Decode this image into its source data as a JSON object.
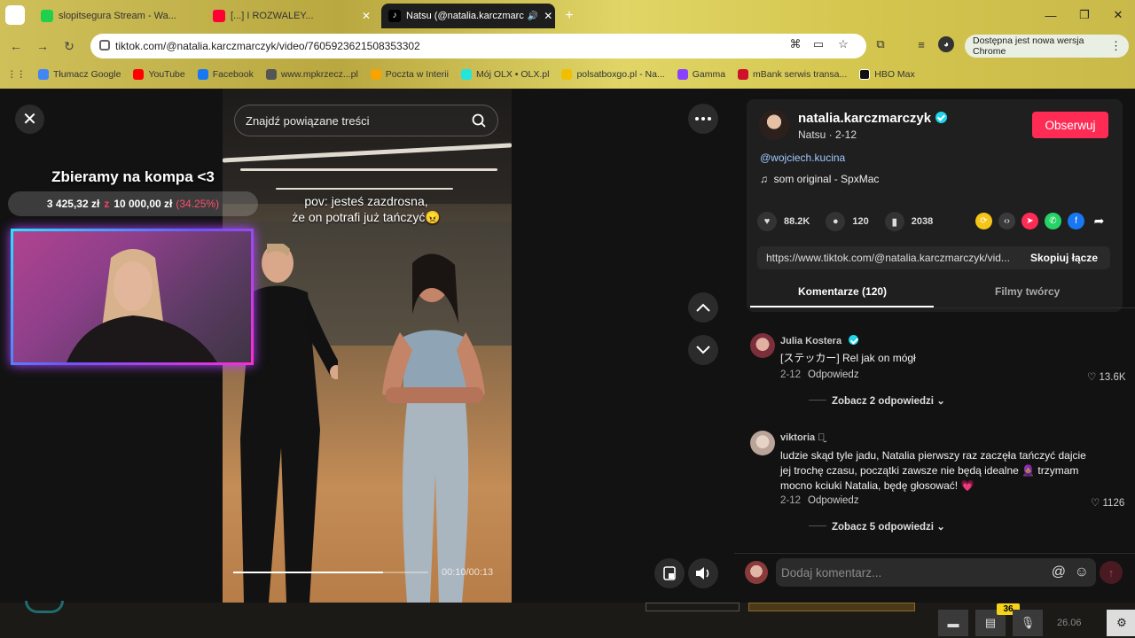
{
  "browser": {
    "tabs": [
      {
        "title": "slopitsegura Stream - Wa...",
        "color": "#20d04a"
      },
      {
        "title": "[...] I ROZWALEY...",
        "color": "#ff0033"
      },
      {
        "title": "Natsu (@natalia.karczmarc",
        "color": "#000000"
      }
    ],
    "new_tab_label": "+",
    "url": "tiktok.com/@natalia.karczmarczyk/video/7605923621508353302",
    "update_label": "Dostępna jest nowa wersja Chrome",
    "bookmarks": [
      {
        "label": "Tłumacz Google",
        "color": "#4285f4"
      },
      {
        "label": "YouTube",
        "color": "#ff0000"
      },
      {
        "label": "Facebook",
        "color": "#1877f2"
      },
      {
        "label": "www.mpkrzecz...pl",
        "color": "#555555"
      },
      {
        "label": "Poczta w Interii",
        "color": "#f7a300"
      },
      {
        "label": "Mój OLX • OLX.pl",
        "color": "#23e5db"
      },
      {
        "label": "polsatboxgo.pl - Na...",
        "color": "#f0c000"
      },
      {
        "label": "Gamma",
        "color": "#8a40ff"
      },
      {
        "label": "mBank serwis transa...",
        "color": "#d0102b"
      },
      {
        "label": "HBO Max",
        "color": "#111111"
      }
    ]
  },
  "player": {
    "search_placeholder": "Znajdź powiązane treści",
    "caption_line1": "pov: jesteś zazdrosna,",
    "caption_line2": "że on potrafi już tańczyć😠",
    "time": "00:10/00:13",
    "progress_fraction": 0.77
  },
  "overlay": {
    "title": "Zbieramy na kompa <3",
    "current": "3 425,32 zł",
    "separator": "z",
    "goal": "10 000,00 zł",
    "percent": "(34.25%)"
  },
  "author": {
    "username": "natalia.karczmarczyk",
    "nickname_date": "Natsu · 2-12",
    "follow_label": "Obserwuj",
    "mention": "@wojciech.kucina",
    "music": "som original - SpxMac"
  },
  "stats": {
    "likes": "88.2K",
    "comments": "120",
    "saves": "2038"
  },
  "share_colors": [
    "#f5c518",
    "#3a3a3a",
    "#fe2c55",
    "#25d366",
    "#1877f2"
  ],
  "link": {
    "url": "https://www.tiktok.com/@natalia.karczmarczyk/vid...",
    "copy_label": "Skopiuj łącze"
  },
  "tabs": {
    "comments": "Komentarze (120)",
    "creator_videos": "Filmy twórcy"
  },
  "comments": [
    {
      "author": "Julia Kostera",
      "text": "[ステッカー] Rel jak on mógł",
      "date": "2-12",
      "reply_label": "Odpowiedz",
      "likes": "13.6K",
      "more": "Zobacz 2 odpowiedzi"
    },
    {
      "author": "viktoria ๑̮",
      "text": "ludzie skąd tyle jadu, Natalia pierwszy raz zaczęła tańczyć dajcie jej trochę czasu, początki zawsze nie będą idealne 🧕🏽 trzymam mocno kciuki Natalia, będę głosować! 💗",
      "date": "2-12",
      "reply_label": "Odpowiedz",
      "likes": "1126",
      "more": "Zobacz 5 odpowiedzi"
    }
  ],
  "comment_input": {
    "placeholder": "Dodaj komentarz..."
  },
  "taskbar": {
    "badge": "36",
    "clock": "26.06"
  }
}
